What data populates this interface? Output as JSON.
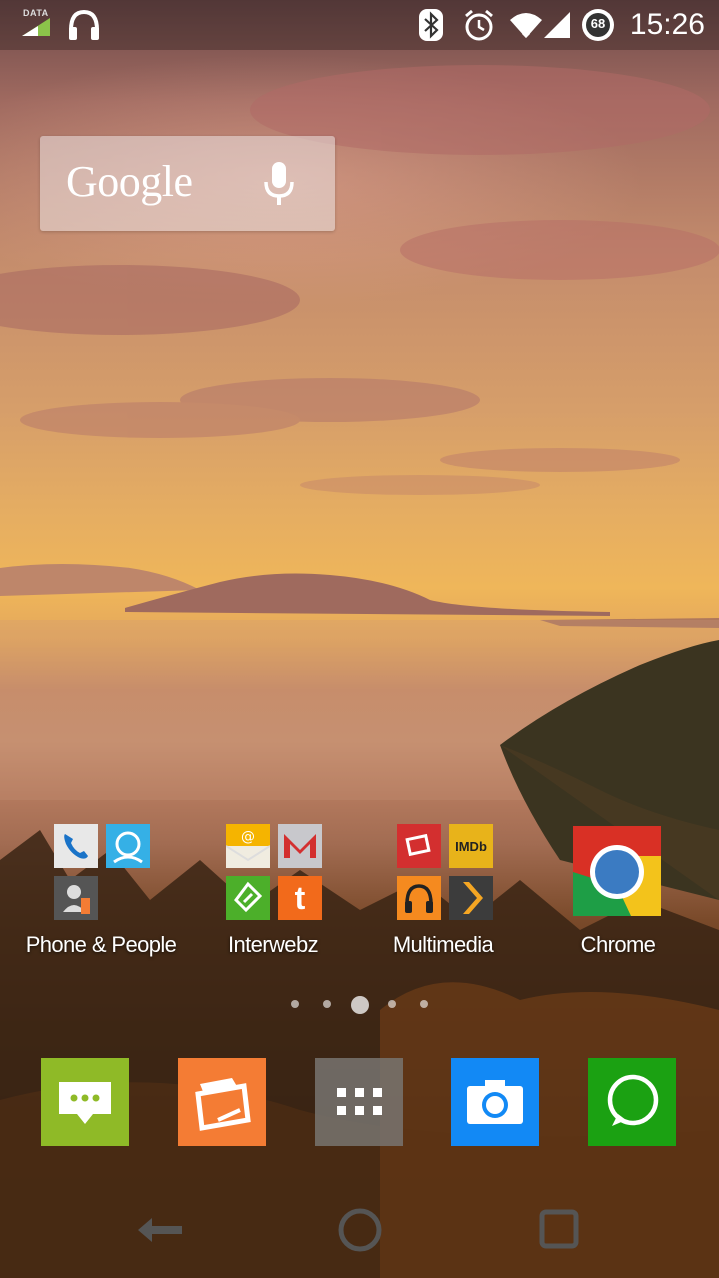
{
  "status_bar": {
    "data_label": "DATA",
    "battery_level": "68",
    "time": "15:26"
  },
  "google_widget": {
    "logo_text": "Google"
  },
  "folders": [
    {
      "label": "Phone & People"
    },
    {
      "label": "Interwebz"
    },
    {
      "label": "Multimedia"
    }
  ],
  "apps": {
    "chrome": {
      "label": "Chrome"
    },
    "imdb_text": "IMDb",
    "tumblr_text": "t"
  },
  "pager": {
    "page_count": 5,
    "current_page": 3
  },
  "colors": {
    "messaging": "#8fba27",
    "wallet": "#f47c34",
    "app_drawer": "#7f7873",
    "camera": "#1289f5",
    "whatsapp": "#1ba112"
  }
}
